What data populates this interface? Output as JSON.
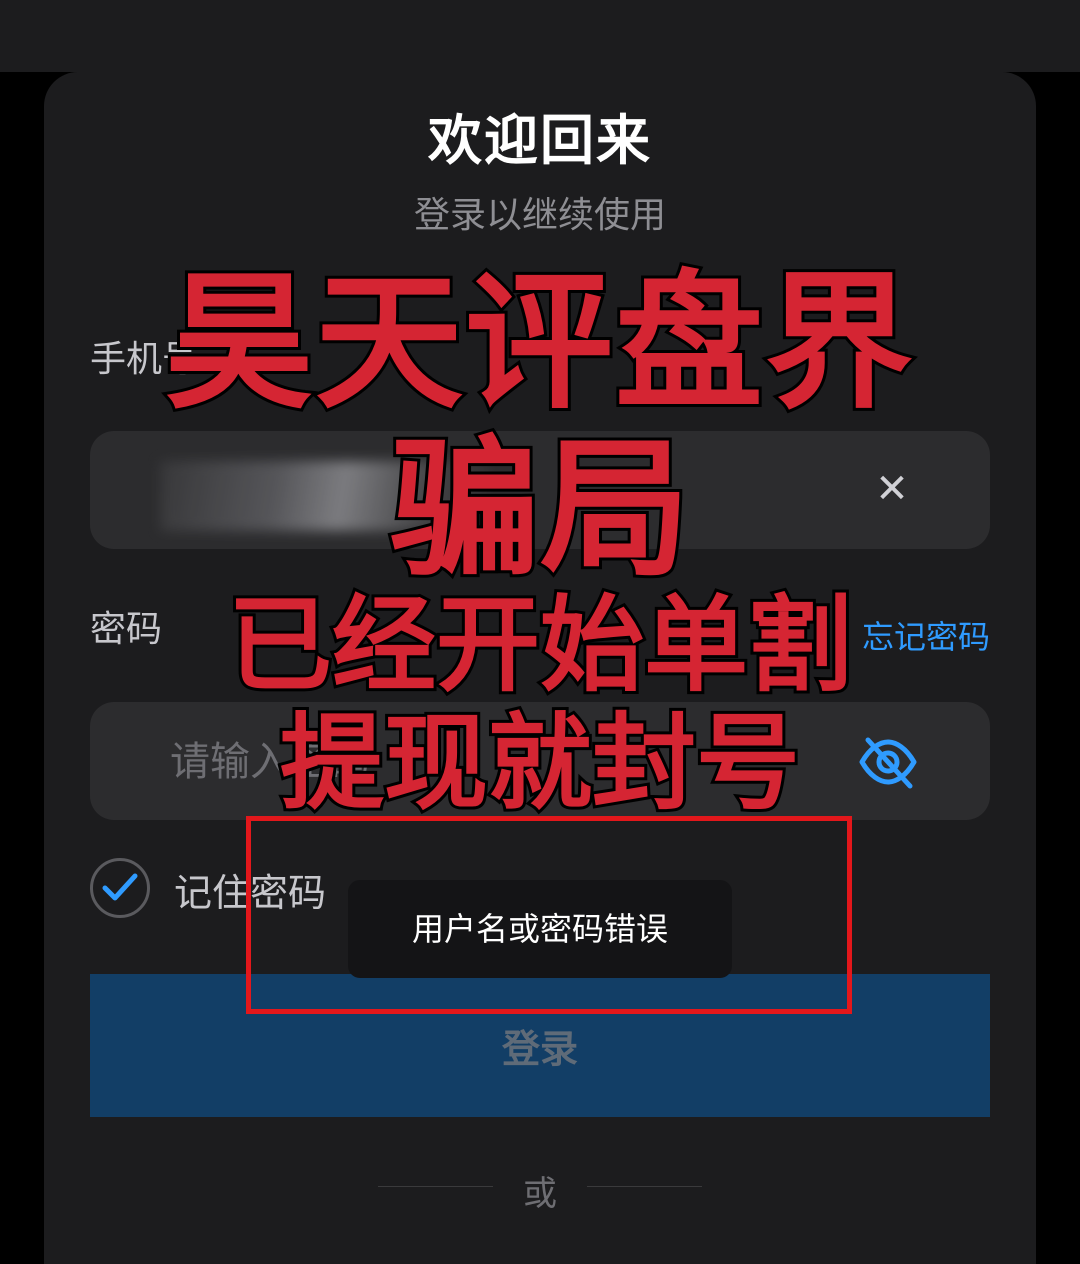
{
  "header": {
    "title": "欢迎回来",
    "subtitle": "登录以继续使用"
  },
  "form": {
    "phone_label": "手机号",
    "phone_value": "",
    "clear_icon": "close-icon",
    "password_label": "密码",
    "forgot_password": "忘记密码",
    "password_placeholder": "请输入密码",
    "eye_icon": "eye-off-icon",
    "remember_label": "记住密码",
    "remember_checked": true,
    "login_label": "登录",
    "or_text": "或"
  },
  "toast": {
    "message": "用户名或密码错误"
  },
  "overlay": {
    "line1": "昊天评盘界",
    "line2": "骗局",
    "line3": "已经开始单割",
    "line4": "提现就封号"
  },
  "colors": {
    "accent": "#2f9bff",
    "button": "#123e66",
    "overlay_text": "#d52533",
    "highlight_box": "#e3171b"
  }
}
